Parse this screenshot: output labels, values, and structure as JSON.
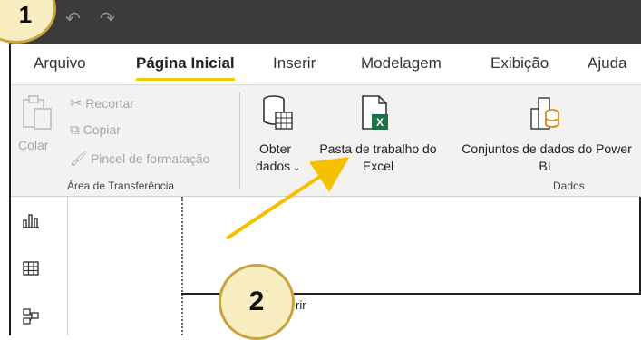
{
  "badges": {
    "one": "1",
    "two": "2"
  },
  "menu": {
    "arquivo": "Arquivo",
    "pagina_inicial": "Página Inicial",
    "inserir": "Inserir",
    "modelagem": "Modelagem",
    "exibicao": "Exibição",
    "ajuda": "Ajuda"
  },
  "clipboard": {
    "colar": "Colar",
    "recortar": "Recortar",
    "copiar": "Copiar",
    "pincel": "Pincel de formatação",
    "group": "Área de Transferência"
  },
  "dados": {
    "obter_line1": "Obter",
    "obter_line2": "dados",
    "pasta_line1": "Pasta de trabalho do",
    "pasta_line2": "Excel",
    "conjuntos_line1": "Conjuntos de dados do Power",
    "conjuntos_line2": "BI",
    "group": "Dados"
  },
  "canvas": {
    "fragment": "rir"
  },
  "colors": {
    "accent": "#f2c811",
    "excel_green": "#1e7145",
    "badge_border": "#c9a43a",
    "arrow": "#f5c000"
  }
}
